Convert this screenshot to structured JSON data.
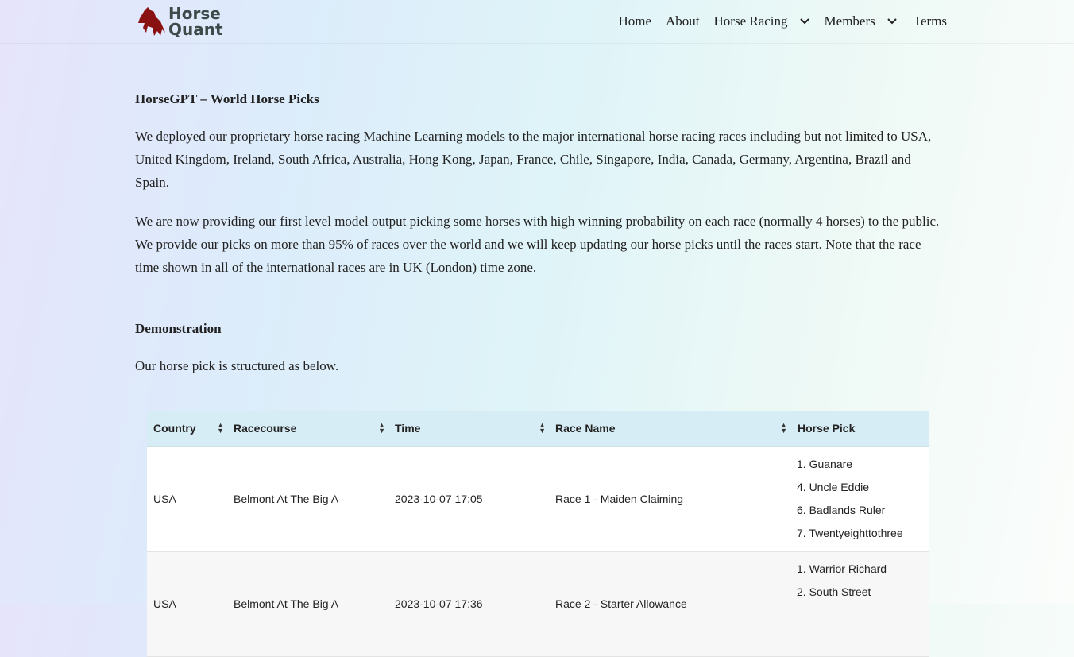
{
  "header": {
    "logo_line1": "Horse",
    "logo_line2": "Quant",
    "nav": [
      {
        "label": "Home"
      },
      {
        "label": "About"
      },
      {
        "label": "Horse Racing",
        "dropdown": true
      },
      {
        "label": "Members",
        "dropdown": true
      },
      {
        "label": "Terms"
      }
    ]
  },
  "content": {
    "title": "HorseGPT – World Horse Picks",
    "para1": "We deployed our proprietary horse racing Machine Learning models to the major international horse racing races  including but not limited to USA, United Kingdom, Ireland, South Africa, Australia, Hong Kong, Japan, France, Chile, Singapore, India, Canada, Germany, Argentina, Brazil and Spain.",
    "para2": "We are now providing our first level model output picking some horses with high winning probability on each race (normally 4 horses) to the public. We provide our picks on more than 95% of races over the world and we will keep updating our horse picks until the races start. Note that the race time shown in all of the international races are in UK (London) time zone.",
    "demo_title": "Demonstration",
    "demo_text": "Our horse pick is structured as below."
  },
  "table": {
    "columns": [
      "Country",
      "Racecourse",
      "Time",
      "Race Name",
      "Horse Pick"
    ],
    "rows": [
      {
        "country": "USA",
        "racecourse": "Belmont At The Big A",
        "time": "2023-10-07 17:05",
        "race": "Race 1 - Maiden Claiming",
        "picks": [
          "1. Guanare",
          "4. Uncle Eddie",
          "6. Badlands Ruler",
          "7. Twentyeighttothree"
        ]
      },
      {
        "country": "USA",
        "racecourse": "Belmont At The Big A",
        "time": "2023-10-07 17:36",
        "race": "Race 2 - Starter Allowance",
        "picks": [
          "1. Warrior Richard",
          "2. South Street"
        ]
      }
    ]
  }
}
